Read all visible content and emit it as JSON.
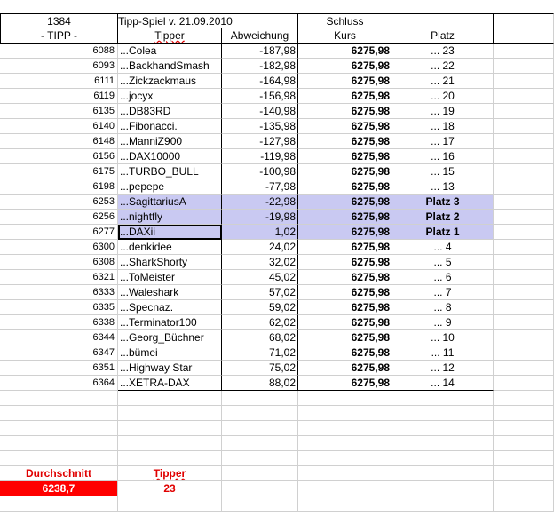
{
  "header": {
    "id": "1384",
    "title": "Tipp-Spiel v. 21.09.2010",
    "schluss": "Schluss",
    "tipp": "- TIPP -",
    "tipper": "Tipper",
    "abweichung": "Abweichung",
    "kurs": "Kurs",
    "platz": "Platz"
  },
  "rows": [
    {
      "tipp": "6088",
      "name": "...Colea",
      "abw": "-187,98",
      "kurs": "6275,98",
      "platz": "... 23"
    },
    {
      "tipp": "6093",
      "name": "...BackhandSmash",
      "abw": "-182,98",
      "kurs": "6275,98",
      "platz": "... 22"
    },
    {
      "tipp": "6111",
      "name": "...Zickzackmaus",
      "abw": "-164,98",
      "kurs": "6275,98",
      "platz": "... 21"
    },
    {
      "tipp": "6119",
      "name": "...jocyx",
      "abw": "-156,98",
      "kurs": "6275,98",
      "platz": "... 20"
    },
    {
      "tipp": "6135",
      "name": "...DB83RD",
      "abw": "-140,98",
      "kurs": "6275,98",
      "platz": "... 19"
    },
    {
      "tipp": "6140",
      "name": "...Fibonacci.",
      "abw": "-135,98",
      "kurs": "6275,98",
      "platz": "... 18"
    },
    {
      "tipp": "6148",
      "name": "...ManniZ900",
      "abw": "-127,98",
      "kurs": "6275,98",
      "platz": "... 17"
    },
    {
      "tipp": "6156",
      "name": "...DAX10000",
      "abw": "-119,98",
      "kurs": "6275,98",
      "platz": "... 16"
    },
    {
      "tipp": "6175",
      "name": "...TURBO_BULL",
      "abw": "-100,98",
      "kurs": "6275,98",
      "platz": "... 15"
    },
    {
      "tipp": "6198",
      "name": "...pepepe",
      "abw": "-77,98",
      "kurs": "6275,98",
      "platz": "... 13"
    },
    {
      "tipp": "6253",
      "name": "...SagittariusA",
      "abw": "-22,98",
      "kurs": "6275,98",
      "platz": "Platz 3"
    },
    {
      "tipp": "6256",
      "name": "...nightfly",
      "abw": "-19,98",
      "kurs": "6275,98",
      "platz": "Platz 2"
    },
    {
      "tipp": "6277",
      "name": "...DAXii",
      "abw": "1,02",
      "kurs": "6275,98",
      "platz": "Platz 1"
    },
    {
      "tipp": "6300",
      "name": "...denkidee",
      "abw": "24,02",
      "kurs": "6275,98",
      "platz": "... 4"
    },
    {
      "tipp": "6308",
      "name": "...SharkShorty",
      "abw": "32,02",
      "kurs": "6275,98",
      "platz": "... 5"
    },
    {
      "tipp": "6321",
      "name": "...ToMeister",
      "abw": "45,02",
      "kurs": "6275,98",
      "platz": "... 6"
    },
    {
      "tipp": "6333",
      "name": "...Waleshark",
      "abw": "57,02",
      "kurs": "6275,98",
      "platz": "... 7"
    },
    {
      "tipp": "6335",
      "name": "...Specnaz.",
      "abw": "59,02",
      "kurs": "6275,98",
      "platz": "... 8"
    },
    {
      "tipp": "6338",
      "name": "...Terminator100",
      "abw": "62,02",
      "kurs": "6275,98",
      "platz": "... 9"
    },
    {
      "tipp": "6344",
      "name": "...Georg_Büchner",
      "abw": "68,02",
      "kurs": "6275,98",
      "platz": "... 10"
    },
    {
      "tipp": "6347",
      "name": "...bümei",
      "abw": "71,02",
      "kurs": "6275,98",
      "platz": "... 11"
    },
    {
      "tipp": "6351",
      "name": "...Highway Star",
      "abw": "75,02",
      "kurs": "6275,98",
      "platz": "... 12"
    },
    {
      "tipp": "6364",
      "name": "...XETRA-DAX",
      "abw": "88,02",
      "kurs": "6275,98",
      "platz": "... 14"
    }
  ],
  "summary": {
    "durchschnitt_label": "Durchschnitt",
    "durchschnitt_value": "6238,7",
    "tipper_label": "Tipper",
    "tipper_value": "23"
  },
  "colors": {
    "highlight": "#c9c9f2",
    "red": "#ff0000"
  }
}
